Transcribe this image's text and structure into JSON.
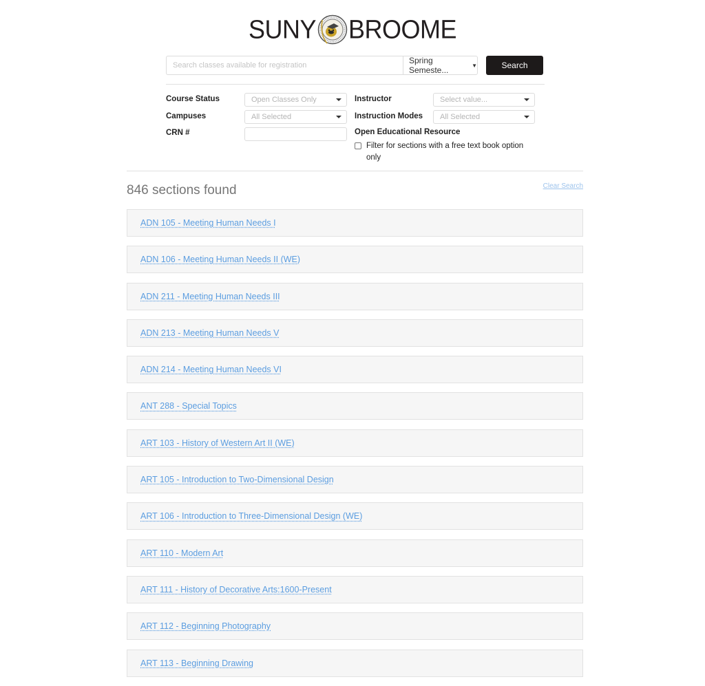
{
  "header": {
    "logo_left": "SUNY",
    "logo_right": "BROOME",
    "seal_icon": "college-seal-icon"
  },
  "search": {
    "placeholder": "Search classes available for registration",
    "value": "",
    "term_selected": "Spring Semeste...",
    "button_label": "Search"
  },
  "filters": {
    "course_status": {
      "label": "Course Status",
      "value": "Open Classes Only"
    },
    "campuses": {
      "label": "Campuses",
      "value": "All Selected"
    },
    "crn": {
      "label": "CRN #",
      "value": ""
    },
    "instructor": {
      "label": "Instructor",
      "placeholder": "Select value..."
    },
    "instruction_modes": {
      "label": "Instruction Modes",
      "value": "All Selected"
    },
    "oer": {
      "title": "Open Educational Resource",
      "checkbox_label": "Filter for sections with a free text book option only",
      "checked": false
    }
  },
  "results": {
    "count_text": "846 sections found",
    "clear_label": "Clear Search",
    "items": [
      "ADN 105 - Meeting Human Needs I",
      "ADN 106 - Meeting Human Needs II (WE)",
      "ADN 211 - Meeting Human Needs III",
      "ADN 213 - Meeting Human Needs V",
      "ADN 214 - Meeting Human Needs VI",
      "ANT 288 - Special Topics",
      "ART 103 - History of Western Art II (WE)",
      "ART 105 - Introduction to Two-Dimensional Design",
      "ART 106 - Introduction to Three-Dimensional Design (WE)",
      "ART 110 - Modern Art",
      "ART 111 - History of Decorative Arts:1600-Present",
      "ART 112 - Beginning Photography",
      "ART 113 - Beginning Drawing"
    ]
  },
  "colors": {
    "link": "#5b9de0",
    "button_bg": "#1d1a1a",
    "item_bg": "#f6f6f6",
    "seal_gold": "#c9a227"
  }
}
